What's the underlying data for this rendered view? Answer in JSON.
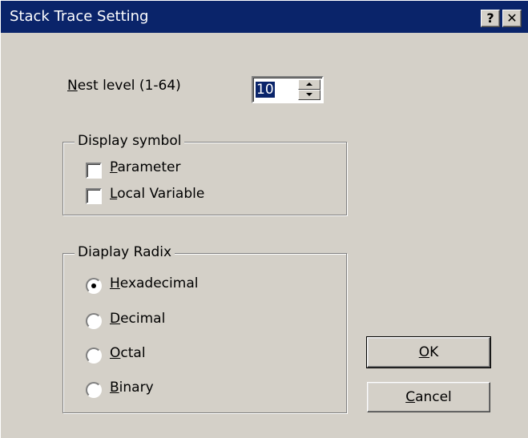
{
  "window": {
    "title": "Stack Trace Setting",
    "help_label": "?",
    "close_label": "✕"
  },
  "nest": {
    "label_mnemonic": "N",
    "label_rest": "est level (1-64)",
    "value": "10"
  },
  "display_symbol": {
    "title": "Display symbol",
    "options": [
      {
        "mnemonic": "P",
        "rest": "arameter",
        "checked": false
      },
      {
        "mnemonic": "L",
        "rest": "ocal Variable",
        "checked": false
      }
    ]
  },
  "display_radix": {
    "title": "Diaplay Radix",
    "options": [
      {
        "mnemonic": "H",
        "rest": "exadecimal",
        "selected": true
      },
      {
        "mnemonic": "D",
        "rest": "ecimal",
        "selected": false
      },
      {
        "mnemonic": "O",
        "rest": "ctal",
        "selected": false
      },
      {
        "mnemonic": "B",
        "rest": "inary",
        "selected": false
      }
    ]
  },
  "buttons": {
    "ok_mnemonic": "O",
    "ok_rest": "K",
    "cancel_mnemonic": "C",
    "cancel_rest": "ancel"
  }
}
